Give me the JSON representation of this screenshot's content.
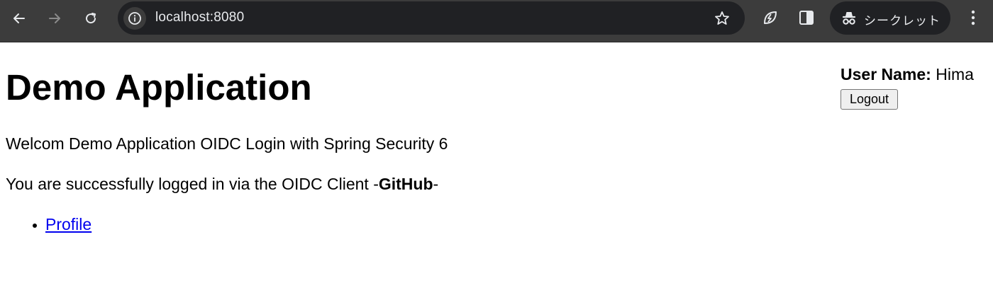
{
  "browser": {
    "url": "localhost:8080",
    "profile_label": "シークレット",
    "icons": {
      "back": "arrow-left-icon",
      "forward": "arrow-right-icon",
      "reload": "reload-icon",
      "info": "info-icon",
      "bookmark": "star-icon",
      "extension": "leaf-icon",
      "side_panel": "side-panel-icon",
      "incognito": "incognito-icon",
      "menu": "more-vert-icon"
    },
    "colors": {
      "toolbar": "#3c3c3c",
      "omnibox": "#202124",
      "text": "#e8eaed"
    }
  },
  "page": {
    "title": "Demo Application",
    "welcome_text": "Welcom Demo Application OIDC Login with Spring Security 6",
    "login_prefix": "You are successfully logged in via the OIDC Client -",
    "login_client": "GitHub",
    "login_suffix": "-",
    "links": [
      {
        "label": "Profile"
      }
    ],
    "user": {
      "label": "User Name:",
      "name": "Hima",
      "logout_label": "Logout"
    },
    "colors": {
      "link": "#0000ee"
    }
  }
}
